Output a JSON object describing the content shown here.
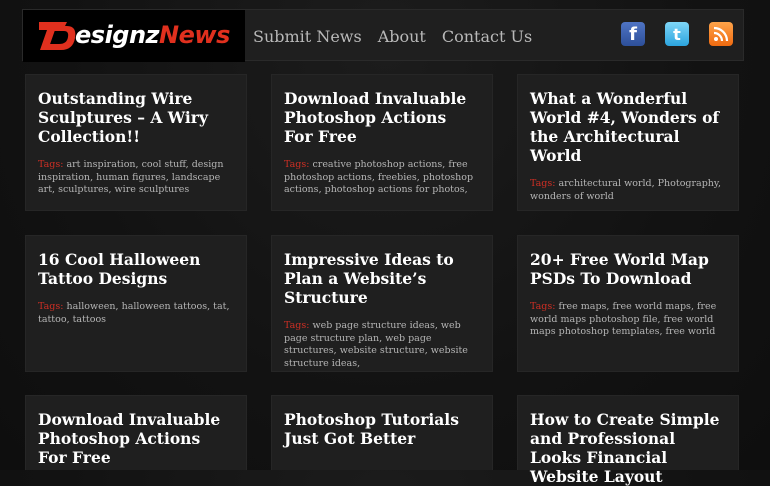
{
  "logo": {
    "mark": "D",
    "text_white": "esignz",
    "text_red": "News"
  },
  "nav": [
    {
      "label": "Submit News"
    },
    {
      "label": "About"
    },
    {
      "label": "Contact Us"
    }
  ],
  "social": [
    {
      "icon": "facebook-icon",
      "glyph": "f",
      "color": "#3b5998"
    },
    {
      "icon": "twitter-icon",
      "glyph": "t",
      "color": "#33ccff"
    },
    {
      "icon": "rss-icon",
      "glyph": "",
      "color": "#f26522"
    }
  ],
  "tags_label": "Tags:",
  "cards": [
    {
      "title": "Outstanding Wire Sculptures – A Wiry Collection!!",
      "tags": [
        "art inspiration",
        "cool stuff",
        "design inspiration",
        "human figures",
        "landscape art",
        "sculptures",
        "wire sculptures"
      ]
    },
    {
      "title": "Download Invaluable Photoshop Actions For Free",
      "tags": [
        "creative photoshop actions",
        "free photoshop actions",
        "freebies",
        "photoshop actions",
        "photoshop actions for photos",
        ""
      ]
    },
    {
      "title": "What a Wonderful World #4, Wonders of the Architectural World",
      "tags": [
        "architectural world",
        "Photography",
        "wonders of world"
      ]
    },
    {
      "title": "16 Cool Halloween Tattoo Designs",
      "tags": [
        "halloween",
        "halloween tattoos",
        "tat",
        "tattoo",
        "tattoos"
      ]
    },
    {
      "title": "Impressive Ideas to Plan a Website’s Structure",
      "tags": [
        "web page structure ideas",
        "web page structure plan",
        "web page structures",
        "website structure",
        "website structure ideas",
        ""
      ]
    },
    {
      "title": "20+ Free World Map PSDs To Download",
      "tags": [
        "free maps",
        "free world maps",
        "free world maps photoshop file",
        "free world maps photoshop templates",
        "free world"
      ]
    },
    {
      "title": "Download Invaluable Photoshop Actions For Free",
      "tags": []
    },
    {
      "title": "Photoshop Tutorials Just Got Better",
      "tags": []
    },
    {
      "title": "How to Create Simple and Professional Looks Financial Website Layout",
      "tags": []
    }
  ],
  "colors": {
    "background": "#111111",
    "card": "#1f1f1f",
    "accent": "#cf2f24"
  }
}
